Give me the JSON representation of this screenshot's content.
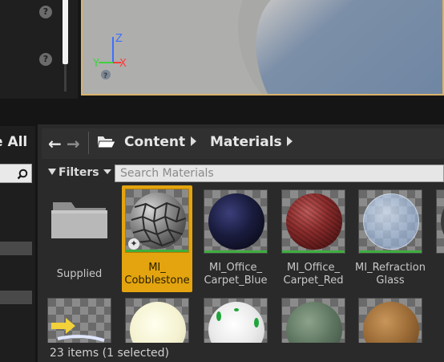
{
  "sources": {
    "save_all_label": "e All"
  },
  "viewport": {
    "axis_z": "Z",
    "axis_y": "Y",
    "axis_x": "X"
  },
  "nav": {
    "back_arrow": "←",
    "forward_arrow": "→",
    "breadcrumbs": [
      "Content",
      "Materials"
    ]
  },
  "toolbar": {
    "filters_label": "Filters",
    "search_placeholder": "Search Materials"
  },
  "assets": [
    {
      "name": "Supplied",
      "kind": "folder",
      "selected": false
    },
    {
      "name": "MI_\nCobblestone",
      "kind": "material",
      "selected": true
    },
    {
      "name": "MI_Office_\nCarpet_Blue",
      "kind": "material",
      "selected": false
    },
    {
      "name": "MI_Office_\nCarpet_Red",
      "kind": "material",
      "selected": false
    },
    {
      "name": "MI_Refraction\nGlass",
      "kind": "material",
      "selected": false
    }
  ],
  "status": {
    "text": "23 items (1 selected)"
  },
  "colors": {
    "selection": "#e3a40f",
    "viewport_border": "#d9b26b",
    "axis_z": "#3d6fff",
    "axis_y": "#3fd23f",
    "axis_x": "#ff3b3b"
  },
  "icons": [
    "help-icon",
    "folder-icon",
    "funnel-icon",
    "search-icon",
    "back-arrow-icon",
    "forward-arrow-icon",
    "breadcrumb-chevron-icon",
    "material-instance-badge-icon"
  ]
}
